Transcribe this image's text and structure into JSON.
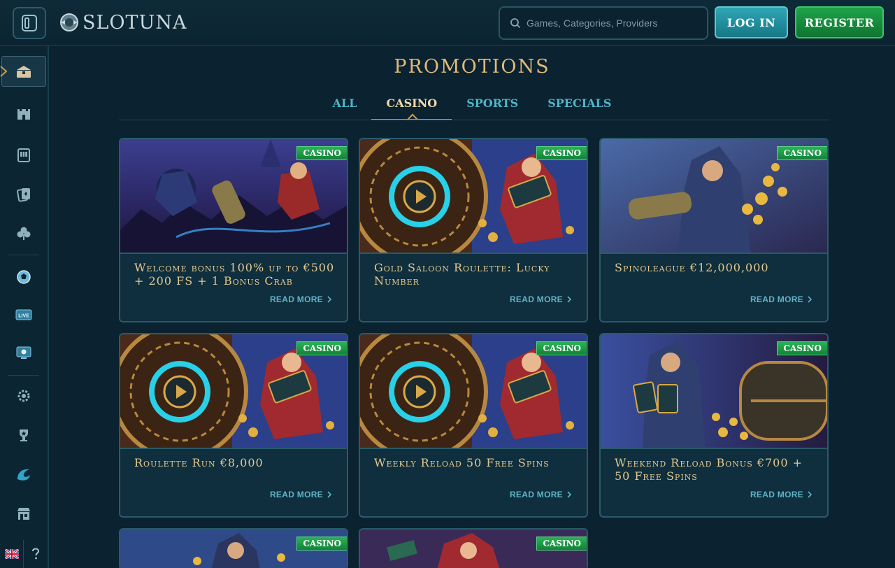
{
  "header": {
    "logo_text": "SLOTUNA",
    "search_placeholder": "Games, Categories, Providers",
    "login_label": "LOG IN",
    "register_label": "REGISTER"
  },
  "sidebar": {
    "items": [
      {
        "icon": "promotions-chest-icon"
      },
      {
        "icon": "castle-icon"
      },
      {
        "icon": "slot-machine-icon"
      },
      {
        "icon": "cards-icon"
      },
      {
        "icon": "clover-icon"
      },
      {
        "icon": "soccer-ball-icon"
      },
      {
        "icon": "live-icon",
        "text": "LIVE"
      },
      {
        "icon": "esports-icon"
      },
      {
        "icon": "settings-gear-icon"
      },
      {
        "icon": "trophy-icon"
      },
      {
        "icon": "wave-icon"
      },
      {
        "icon": "shop-icon"
      }
    ],
    "language_flag": "uk-flag-icon",
    "help_icon": "question-icon"
  },
  "page": {
    "title": "PROMOTIONS",
    "tabs": [
      {
        "label": "ALL"
      },
      {
        "label": "CASINO"
      },
      {
        "label": "SPORTS"
      },
      {
        "label": "SPECIALS"
      }
    ],
    "active_tab": "CASINO"
  },
  "promotions": [
    {
      "badge": "CASINO",
      "title": "Welcome bonus 100% up to €500 + 200 FS + 1 Bonus Crab",
      "read_more": "READ MORE"
    },
    {
      "badge": "CASINO",
      "title": "Gold Saloon Roulette: Lucky Number",
      "read_more": "READ MORE"
    },
    {
      "badge": "CASINO",
      "title": "Spinoleague €12,000,000",
      "read_more": "READ MORE"
    },
    {
      "badge": "CASINO",
      "title": "Roulette Run €8,000",
      "read_more": "READ MORE"
    },
    {
      "badge": "CASINO",
      "title": "Weekly Reload 50 Free Spins",
      "read_more": "READ MORE"
    },
    {
      "badge": "CASINO",
      "title": "Weekend Reload Bonus €700 + 50 Free Spins",
      "read_more": "READ MORE"
    },
    {
      "badge": "CASINO"
    },
    {
      "badge": "CASINO"
    }
  ],
  "colors": {
    "background": "#0b2230",
    "title_gold": "#e0b97a",
    "tab_cyan": "#4fb6c9",
    "login_teal": "#1f8e9c",
    "register_green": "#1a9a44",
    "badge_green": "#22a04c"
  }
}
